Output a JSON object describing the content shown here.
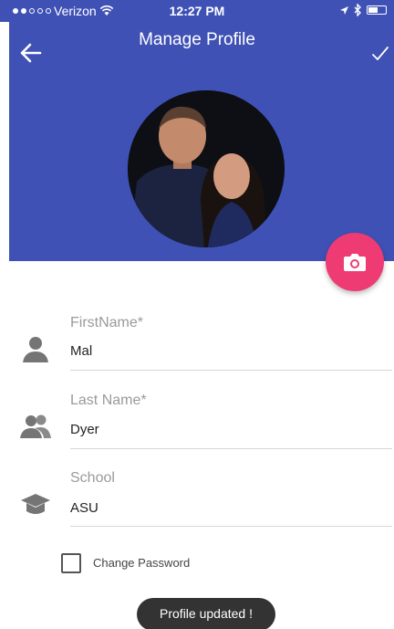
{
  "status_bar": {
    "carrier": "Verizon",
    "time": "12:27 PM",
    "signal_bars_filled": 2,
    "signal_bars_total": 5
  },
  "app_bar": {
    "title": "Manage Profile",
    "back_icon": "arrow-left-icon",
    "save_icon": "check-icon"
  },
  "profile": {
    "avatar_icon": "profile-photo",
    "camera_icon": "camera-icon"
  },
  "form": {
    "first_name": {
      "label": "FirstName*",
      "value": "Mal",
      "icon": "person-icon"
    },
    "last_name": {
      "label": "Last Name*",
      "value": "Dyer",
      "icon": "people-icon"
    },
    "school": {
      "label": "School",
      "value": "ASU",
      "icon": "school-cap-icon"
    },
    "change_password": {
      "label": "Change Password",
      "checked": false
    }
  },
  "toast": {
    "message": "Profile updated !"
  },
  "colors": {
    "primary": "#3f51b5",
    "accent": "#ef3b73",
    "toast_bg": "#333333",
    "icon_gray": "#757575"
  }
}
